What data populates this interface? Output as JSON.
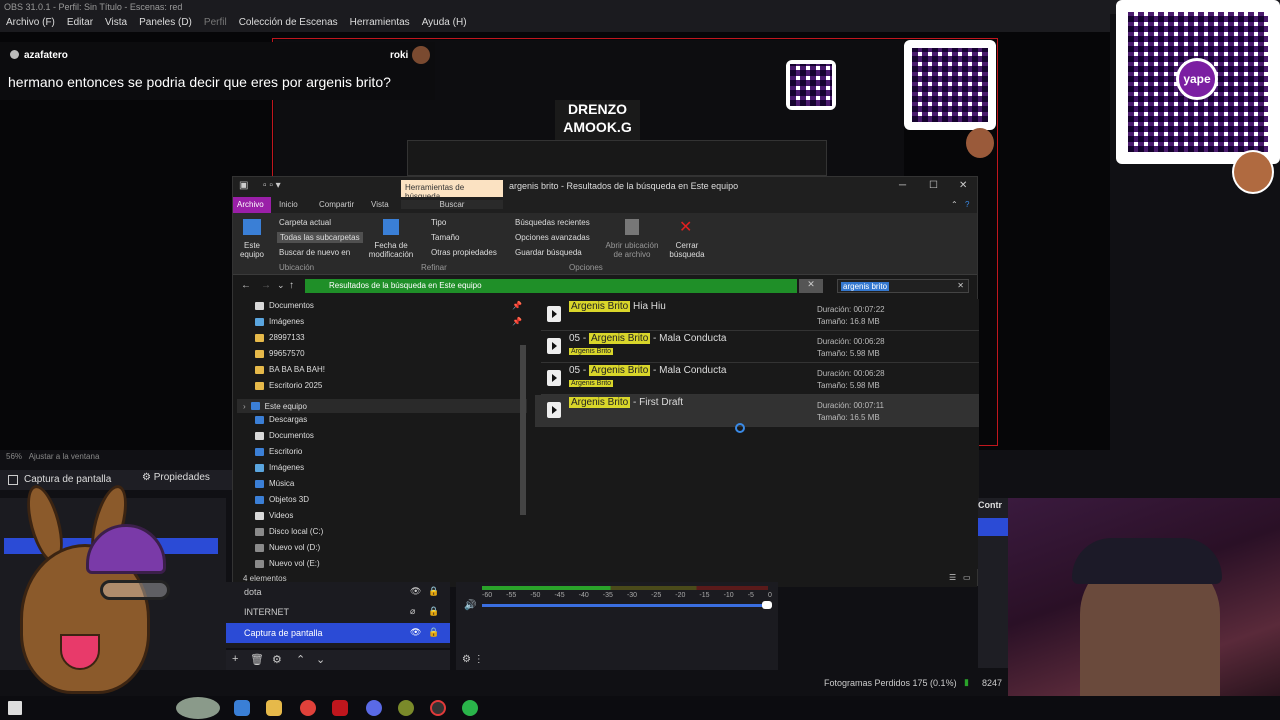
{
  "obs": {
    "title": "OBS 31.0.1 - Perfil: Sin Título - Escenas: red",
    "menu": [
      "Archivo (F)",
      "Editar",
      "Vista",
      "Paneles (D)",
      "Perfil",
      "Colección de Escenas",
      "Herramientas",
      "Ayuda (H)"
    ],
    "zoom": "56%",
    "fit_label": "Ajustar a la ventana",
    "source_header": "Captura de pantalla",
    "properties_label": "Propiedades",
    "sources": [
      {
        "name": "dota",
        "selected": false
      },
      {
        "name": "INTERNET",
        "selected": false
      },
      {
        "name": "Captura de pantalla",
        "selected": true
      }
    ],
    "mixer_ticks": [
      "-60",
      "-55",
      "-50",
      "-45",
      "-40",
      "-35",
      "-30",
      "-25",
      "-20",
      "-15",
      "-10",
      "-5",
      "0"
    ],
    "right_panel_header": "Contr",
    "status": {
      "dropped": "Fotogramas Perdidos 175 (0.1%)",
      "bitrate": "8247"
    }
  },
  "chat": {
    "user": "azafatero",
    "user2": "roki",
    "message": "hermano entonces se podria decir que eres por argenis brito?"
  },
  "explorer": {
    "context_tab": "Herramientas de búsqueda",
    "title": "argenis brito - Resultados de la búsqueda en Este equipo",
    "tabs": [
      "Archivo",
      "Inicio",
      "Compartir",
      "Vista",
      "Buscar"
    ],
    "ribbon": {
      "este_equipo": "Este equipo",
      "carpeta_actual": "Carpeta actual",
      "todas_subcarpetas": "Todas las subcarpetas",
      "buscar_nuevo": "Buscar de nuevo en",
      "fecha": "Fecha de modificación",
      "tipo": "Tipo",
      "tamano": "Tamaño",
      "otras": "Otras propiedades",
      "recientes": "Búsquedas recientes",
      "avanzadas": "Opciones avanzadas",
      "guardar": "Guardar búsqueda",
      "abrir_ubicacion": "Abrir ubicación de archivo",
      "cerrar": "Cerrar búsqueda",
      "groups": [
        "Ubicación",
        "Refinar",
        "Opciones"
      ]
    },
    "address": "Resultados de la búsqueda en Este equipo",
    "search_query": "argenis brito",
    "nav": [
      {
        "label": "Documentos",
        "icon": "doc"
      },
      {
        "label": "Imágenes",
        "icon": "img"
      },
      {
        "label": "28997133",
        "icon": "yellow"
      },
      {
        "label": "99657570",
        "icon": "yellow"
      },
      {
        "label": "BA BA BA BAH!",
        "icon": "yellow"
      },
      {
        "label": "Escritorio 2025",
        "icon": "yellow"
      },
      {
        "label": "Este equipo",
        "icon": "blue"
      },
      {
        "label": "Descargas",
        "icon": "blue"
      },
      {
        "label": "Documentos",
        "icon": "doc"
      },
      {
        "label": "Escritorio",
        "icon": "blue"
      },
      {
        "label": "Imágenes",
        "icon": "img"
      },
      {
        "label": "Música",
        "icon": "blue"
      },
      {
        "label": "Objetos 3D",
        "icon": "blue"
      },
      {
        "label": "Videos",
        "icon": "doc"
      },
      {
        "label": "Disco local (C:)",
        "icon": "drive"
      },
      {
        "label": "Nuevo vol (D:)",
        "icon": "drive"
      },
      {
        "label": "Nuevo vol (E:)",
        "icon": "drive"
      }
    ],
    "results": [
      {
        "prefix": "",
        "match": "Argenis Brito",
        "rest": " Hia Hiu",
        "sub": "",
        "duration": "Duración: 00:07:22",
        "size": "Tamaño: 16.8 MB"
      },
      {
        "prefix": "05 - ",
        "match": "Argenis Brito",
        "rest": " - Mala Conducta",
        "sub": "Argenis Brito",
        "duration": "Duración: 00:06:28",
        "size": "Tamaño: 5.98 MB"
      },
      {
        "prefix": "05 - ",
        "match": "Argenis Brito",
        "rest": " - Mala Conducta",
        "sub": "Argenis Brito",
        "duration": "Duración: 00:06:28",
        "size": "Tamaño: 5.98 MB"
      },
      {
        "prefix": "",
        "match": "Argenis Brito",
        "rest": " - First Draft",
        "sub": "",
        "duration": "Duración: 00:07:11",
        "size": "Tamaño: 16.5 MB"
      }
    ],
    "status": "4 elementos"
  },
  "qr": {
    "badge": "yape"
  },
  "overlay_text": {
    "line1": "DRENZO",
    "line2": "AMOOK.G"
  },
  "colors": {
    "accent": "#c0161d",
    "obs_select": "#2b4bd6",
    "explorer_file_tab": "#9a1fa8",
    "address_green": "#1f8f28",
    "highlight": "#d9d62a"
  }
}
